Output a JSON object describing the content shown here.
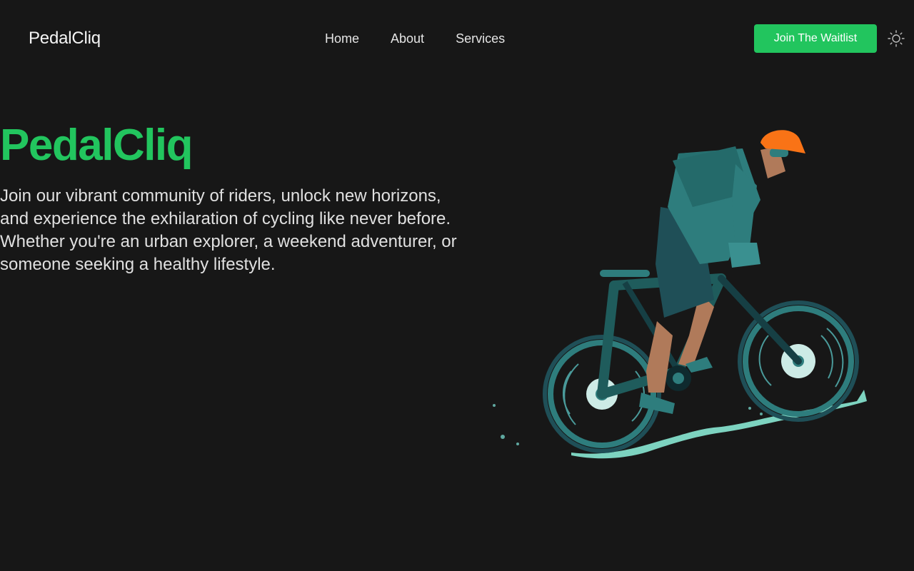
{
  "header": {
    "brand": "PedalCliq",
    "nav": [
      {
        "label": "Home"
      },
      {
        "label": "About"
      },
      {
        "label": "Services"
      }
    ],
    "cta_label": "Join The Waitlist",
    "theme_toggle_icon": "sun-icon"
  },
  "hero": {
    "title": "PedalCliq",
    "description": "Join our vibrant community of riders, unlock new horizons, and experience the exhilaration of cycling like never before. Whether you're an urban explorer, a weekend adventurer, or someone seeking a healthy lifestyle.",
    "illustration": "cyclist-illustration"
  },
  "colors": {
    "background": "#171717",
    "accent": "#22c55e",
    "text": "#e5e5e5",
    "bike_teal": "#2e7d7d",
    "helmet": "#f97316"
  }
}
